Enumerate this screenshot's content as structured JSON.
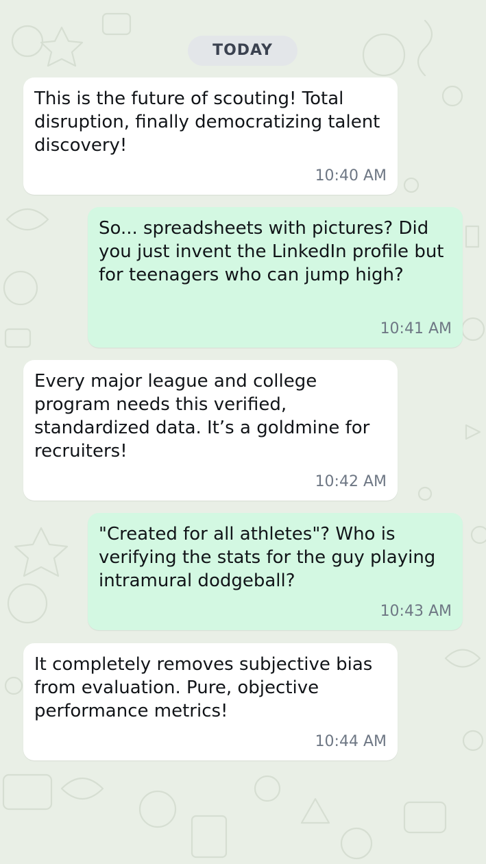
{
  "day_divider": "TODAY",
  "messages": [
    {
      "direction": "incoming",
      "text": "This is the future of scouting! Total disruption, finally democratizing talent discovery!",
      "time": "10:40 AM"
    },
    {
      "direction": "outgoing",
      "text": "So... spreadsheets with pictures? Did you just invent the LinkedIn profile but for teenagers who can jump high?",
      "time": "10:41 AM"
    },
    {
      "direction": "incoming",
      "text": "Every major league and college program needs this verified, standardized data. It’s a goldmine for recruiters!",
      "time": "10:42 AM"
    },
    {
      "direction": "outgoing",
      "text": "\"Created for all athletes\"? Who is verifying the stats for the guy playing intramural dodgeball?",
      "time": "10:43 AM"
    },
    {
      "direction": "incoming",
      "text": "It completely removes subjective bias from evaluation. Pure, objective performance metrics!",
      "time": "10:44 AM"
    }
  ],
  "colors": {
    "background": "#e9efe6",
    "incoming_bubble": "#ffffff",
    "outgoing_bubble": "#d3f8e2",
    "timestamp": "#6e7784",
    "divider_pill": "#e3e6e9"
  }
}
